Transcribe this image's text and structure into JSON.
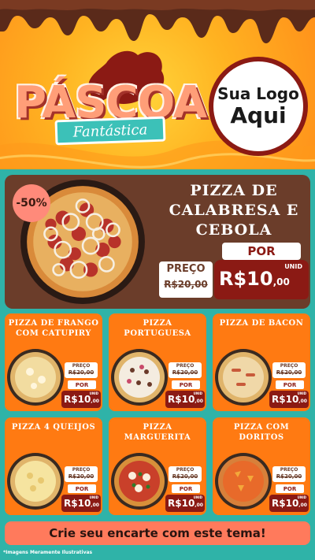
{
  "header": {
    "title": "PÁSCOA",
    "subtitle": "Fantástica",
    "logo_line1": "Sua Logo",
    "logo_line2": "Aqui"
  },
  "hero": {
    "discount": "-50%",
    "name": "PIZZA DE CALABRESA E CEBOLA",
    "preco_label": "PREÇO",
    "old_price": "R$20,00",
    "por_label": "POR",
    "unid_label": "UNID",
    "new_price_main": "R$10",
    "new_price_cents": ",00"
  },
  "cards": [
    {
      "name": "PIZZA DE FRANGO COM CATUPIRY",
      "preco_label": "PREÇO",
      "old_price": "R$20,00",
      "por_label": "POR",
      "unid_label": "UNID",
      "new_price_main": "R$10",
      "new_price_cents": ",00"
    },
    {
      "name": "PIZZA PORTUGUESA",
      "preco_label": "PREÇO",
      "old_price": "R$20,00",
      "por_label": "POR",
      "unid_label": "UNID",
      "new_price_main": "R$10",
      "new_price_cents": ",00"
    },
    {
      "name": "PIZZA DE BACON",
      "preco_label": "PREÇO",
      "old_price": "R$20,00",
      "por_label": "POR",
      "unid_label": "UNID",
      "new_price_main": "R$10",
      "new_price_cents": ",00"
    },
    {
      "name": "PIZZA 4 QUEIJOS",
      "preco_label": "PREÇO",
      "old_price": "R$20,00",
      "por_label": "POR",
      "unid_label": "UNID",
      "new_price_main": "R$10",
      "new_price_cents": ",00"
    },
    {
      "name": "PIZZA MARGUERITA",
      "preco_label": "PREÇO",
      "old_price": "R$20,00",
      "por_label": "POR",
      "unid_label": "UNID",
      "new_price_main": "R$10",
      "new_price_cents": ",00"
    },
    {
      "name": "PIZZA COM DORITOS",
      "preco_label": "PREÇO",
      "old_price": "R$20,00",
      "por_label": "POR",
      "unid_label": "UNID",
      "new_price_main": "R$10",
      "new_price_cents": ",00"
    }
  ],
  "cta": "Crie seu encarte com este tema!",
  "footnote": "*Imagens Meramente Ilustrativas",
  "colors": {
    "background": "#2fb3a8",
    "card": "#ff7a12",
    "hero_panel": "#6b3d2a",
    "price_box": "#8b1a14",
    "cta": "#ff7a5c"
  }
}
